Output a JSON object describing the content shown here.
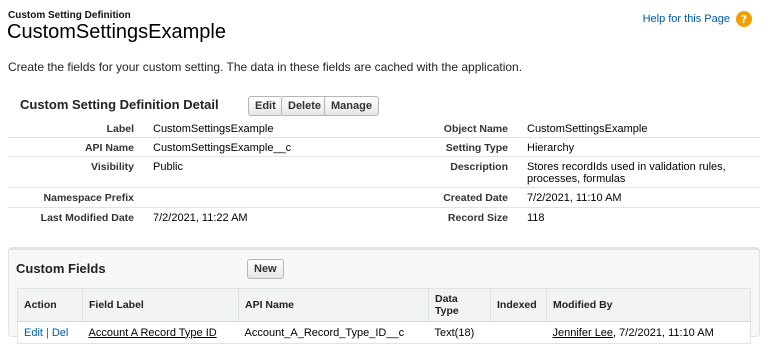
{
  "header": {
    "breadcrumb": "Custom Setting Definition",
    "title": "CustomSettingsExample",
    "help_link": "Help for this Page",
    "help_icon": "question-icon"
  },
  "intro": "Create the fields for your custom setting. The data in these fields are cached with the application.",
  "detail": {
    "heading": "Custom Setting Definition Detail",
    "buttons": {
      "edit": "Edit",
      "delete": "Delete",
      "manage": "Manage"
    },
    "rows": [
      {
        "l1": "Label",
        "v1": "CustomSettingsExample",
        "l2": "Object Name",
        "v2": "CustomSettingsExample"
      },
      {
        "l1": "API Name",
        "v1": "CustomSettingsExample__c",
        "l2": "Setting Type",
        "v2": "Hierarchy"
      },
      {
        "l1": "Visibility",
        "v1": "Public",
        "l2": "Description",
        "v2": "Stores recordIds used in validation rules, processes, formulas"
      },
      {
        "l1": "Namespace Prefix",
        "v1": "",
        "l2": "Created Date",
        "v2": "7/2/2021, 11:10 AM"
      },
      {
        "l1": "Last Modified Date",
        "v1": "7/2/2021, 11:22 AM",
        "l2": "Record Size",
        "v2": "118"
      }
    ]
  },
  "custom_fields": {
    "title": "Custom Fields",
    "new_button": "New",
    "columns": [
      "Action",
      "Field Label",
      "API Name",
      "Data Type",
      "Indexed",
      "Modified By"
    ],
    "rows": [
      {
        "action_edit": "Edit",
        "action_sep": "|",
        "action_del": "Del",
        "field_label": "Account A Record Type ID",
        "api_name": "Account_A_Record_Type_ID__c",
        "data_type": "Text(18)",
        "indexed": "",
        "modified_by_user": "Jennifer Lee",
        "modified_by_date": ", 7/2/2021, 11:10 AM"
      }
    ]
  },
  "colors": {
    "link": "#015ba7",
    "help_icon": "#f2a000"
  }
}
